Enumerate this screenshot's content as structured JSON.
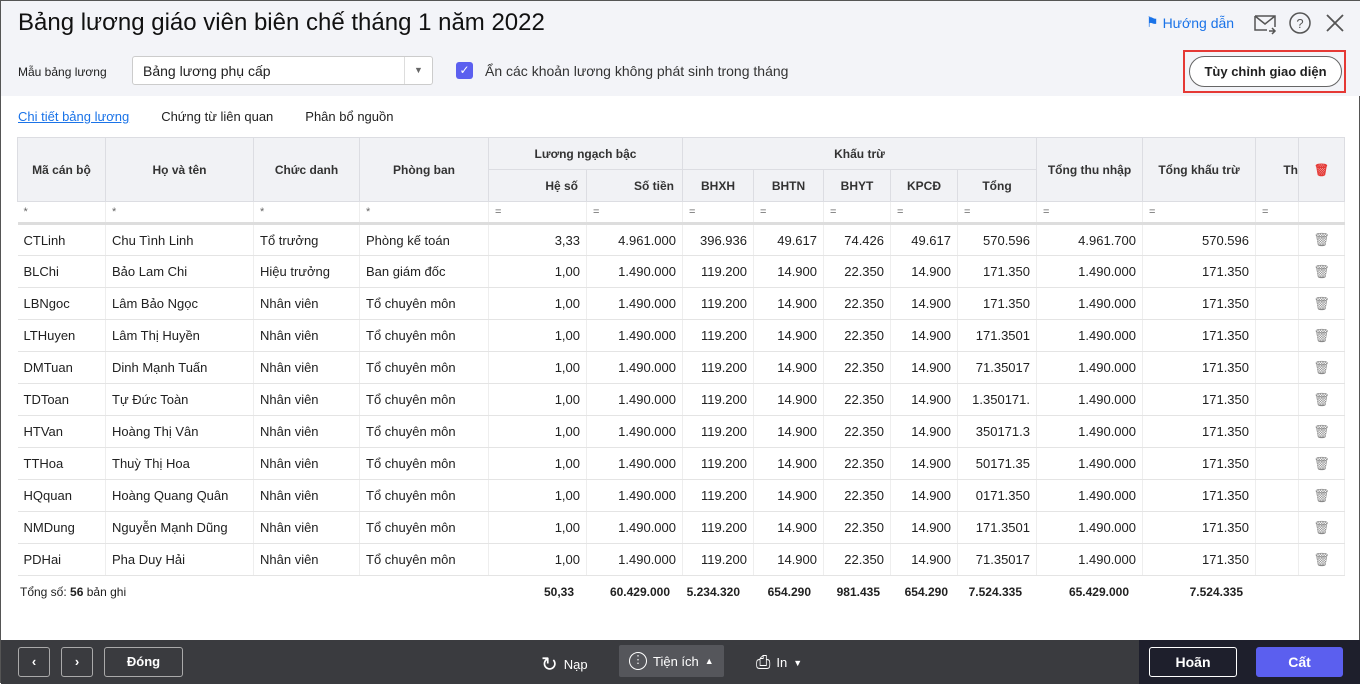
{
  "header": {
    "title": "Bảng lương giáo viên biên chế tháng 1 năm 2022",
    "help": "Hướng dẫn"
  },
  "toolbar": {
    "template_label": "Mẫu bảng lương",
    "template_value": "Bảng lương phụ cấp",
    "hide_label": "Ẩn các khoản lương không phát sinh trong tháng",
    "customize": "Tùy chỉnh giao diện"
  },
  "tabs": [
    "Chi tiết bảng lương",
    "Chứng từ liên quan",
    "Phân bổ nguồn"
  ],
  "columns": {
    "ma": "Mã cán bộ",
    "ten": "Họ và tên",
    "chuc": "Chức danh",
    "phong": "Phòng ban",
    "luong": "Lương ngạch bậc",
    "heso": "Hệ số",
    "sotien": "Số tiền",
    "khautru": "Khấu trừ",
    "bhxh": "BHXH",
    "bhtn": "BHTN",
    "bhyt": "BHYT",
    "kpcd": "KPCĐ",
    "tong": "Tổng",
    "tongthu": "Tổng thu nhập",
    "tongkt": "Tổng khấu trừ",
    "th": "Th"
  },
  "rows": [
    [
      "CTLinh",
      "Chu Tình Linh",
      "Tổ trưởng",
      "Phòng kế toán",
      "3,33",
      "4.961.000",
      "396.936",
      "49.617",
      "74.426",
      "49.617",
      "570.596",
      "4.961.700",
      "570.596"
    ],
    [
      "BLChi",
      "Bảo Lam Chi",
      "Hiệu trưởng",
      "Ban giám đốc",
      "1,00",
      "1.490.000",
      "119.200",
      "14.900",
      "22.350",
      "14.900",
      "171.350",
      "1.490.000",
      "171.350"
    ],
    [
      "LBNgoc",
      "Lâm Bảo Ngọc",
      "Nhân viên",
      "Tổ chuyên môn",
      "1,00",
      "1.490.000",
      "119.200",
      "14.900",
      "22.350",
      "14.900",
      "171.350",
      "1.490.000",
      "171.350"
    ],
    [
      "LTHuyen",
      "Lâm Thị Huyền",
      "Nhân viên",
      "Tổ chuyên môn",
      "1,00",
      "1.490.000",
      "119.200",
      "14.900",
      "22.350",
      "14.900",
      "171.3501",
      "1.490.000",
      "171.350"
    ],
    [
      "DMTuan",
      "Dinh Mạnh Tuấn",
      "Nhân viên",
      "Tổ chuyên môn",
      "1,00",
      "1.490.000",
      "119.200",
      "14.900",
      "22.350",
      "14.900",
      "71.35017",
      "1.490.000",
      "171.350"
    ],
    [
      "TDToan",
      "Tự Đức Toàn",
      "Nhân viên",
      "Tổ chuyên môn",
      "1,00",
      "1.490.000",
      "119.200",
      "14.900",
      "22.350",
      "14.900",
      "1.350171.",
      "1.490.000",
      "171.350"
    ],
    [
      "HTVan",
      "Hoàng Thị Vân",
      "Nhân viên",
      "Tổ chuyên môn",
      "1,00",
      "1.490.000",
      "119.200",
      "14.900",
      "22.350",
      "14.900",
      "350171.3",
      "1.490.000",
      "171.350"
    ],
    [
      "TTHoa",
      "Thuỳ Thị Hoa",
      "Nhân viên",
      "Tổ chuyên môn",
      "1,00",
      "1.490.000",
      "119.200",
      "14.900",
      "22.350",
      "14.900",
      "50171.35",
      "1.490.000",
      "171.350"
    ],
    [
      "HQquan",
      "Hoàng Quang Quân",
      "Nhân viên",
      "Tổ chuyên môn",
      "1,00",
      "1.490.000",
      "119.200",
      "14.900",
      "22.350",
      "14.900",
      "0171.350",
      "1.490.000",
      "171.350"
    ],
    [
      "NMDung",
      "Nguyễn Mạnh Dũng",
      "Nhân viên",
      "Tổ chuyên môn",
      "1,00",
      "1.490.000",
      "119.200",
      "14.900",
      "22.350",
      "14.900",
      "171.3501",
      "1.490.000",
      "171.350"
    ],
    [
      "PDHai",
      "Pha Duy Hải",
      "Nhân viên",
      "Tổ chuyên môn",
      "1,00",
      "1.490.000",
      "119.200",
      "14.900",
      "22.350",
      "14.900",
      "71.35017",
      "1.490.000",
      "171.350"
    ]
  ],
  "footer": {
    "prefix": "Tổng số:",
    "count": "56",
    "suffix": "bản ghi",
    "totals": [
      "50,33",
      "60.429.000",
      "5.234.320",
      "654.290",
      "981.435",
      "654.290",
      "7.524.335",
      "65.429.000",
      "7.524.335"
    ]
  },
  "bottom": {
    "close": "Đóng",
    "reload": "Nạp",
    "utility": "Tiện ích",
    "print": "In",
    "cancel": "Hoãn",
    "save": "Cất"
  }
}
